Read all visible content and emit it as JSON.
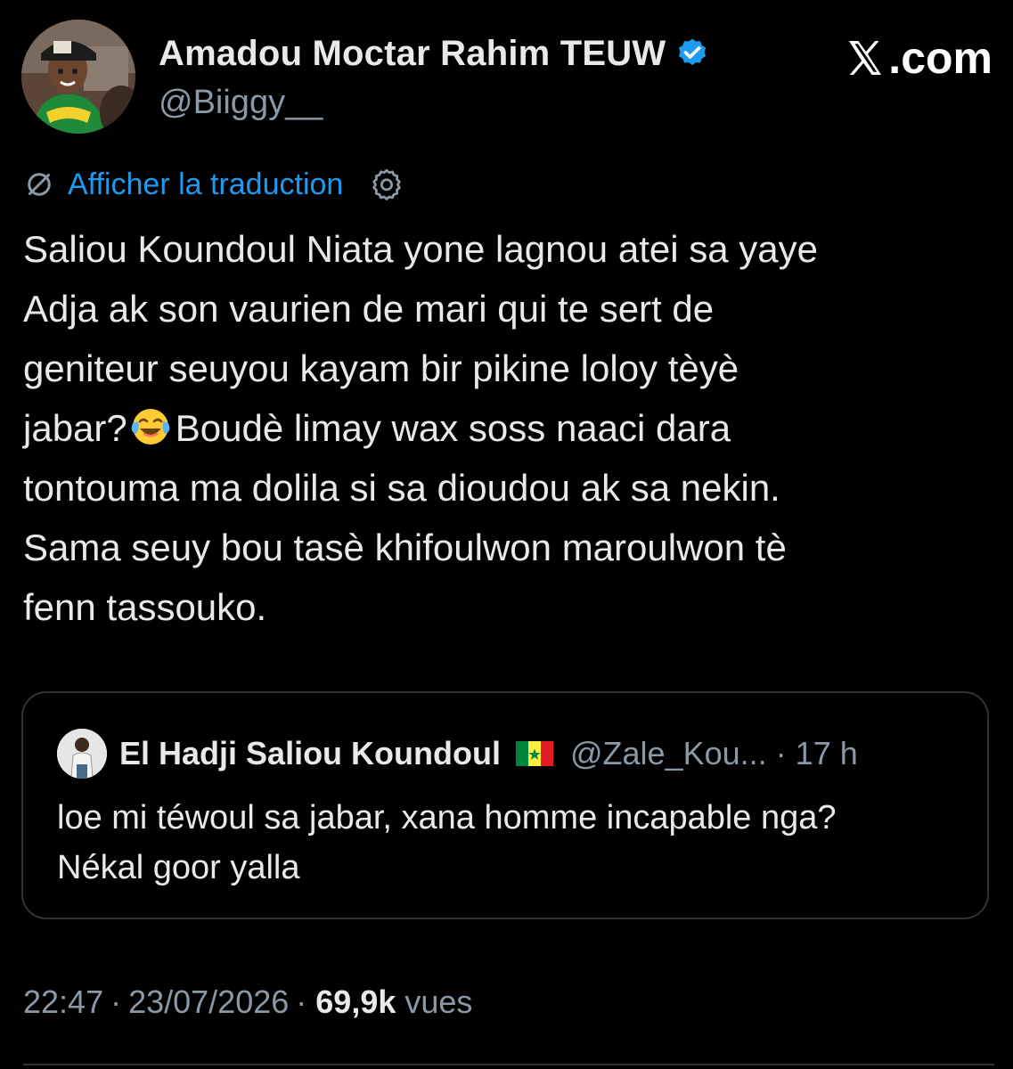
{
  "author": {
    "name": "Amadou Moctar Rahim TEUW",
    "handle": "@Biiggy__",
    "verified": true,
    "verified_color": "#1d9bf0",
    "avatar_icon": "profile-photo"
  },
  "site": {
    "mark_icon": "x-logo-icon",
    "suffix": ".com"
  },
  "translation": {
    "icon": "translate-icon",
    "link_text": "Afficher la traduction",
    "settings_icon": "gear-icon"
  },
  "tweet": {
    "lines": [
      "Saliou Koundoul Niata yone lagnou atei sa yaye",
      "Adja ak son vaurien de mari qui te sert de",
      "geniteur seuyou kayam bir pikine loloy tèyè",
      "jabar?",
      "Boudè limay wax soss naaci dara",
      "tontouma ma dolila si sa dioudou ak sa nekin.",
      "Sama seuy bou tasè khifoulwon maroulwon tè",
      "fenn tassouko."
    ],
    "emoji": "face-with-tears-of-joy"
  },
  "quote": {
    "author_name": "El Hadji Saliou Koundoul",
    "flag": "senegal-flag",
    "handle": "@Zale_Kou...",
    "separator": "·",
    "time": "17 h",
    "lines": [
      "loe mi téwoul sa jabar, xana homme incapable nga?",
      "Nékal goor yalla"
    ]
  },
  "meta": {
    "time": "22:47",
    "separator": "·",
    "date": "23/07/2026",
    "views_count": "69,9k",
    "views_label": "vues"
  },
  "colors": {
    "background": "#000000",
    "text": "#e7e9ea",
    "secondary_text": "#8b98a5",
    "link": "#1d9bf0",
    "border": "#2f3336"
  }
}
